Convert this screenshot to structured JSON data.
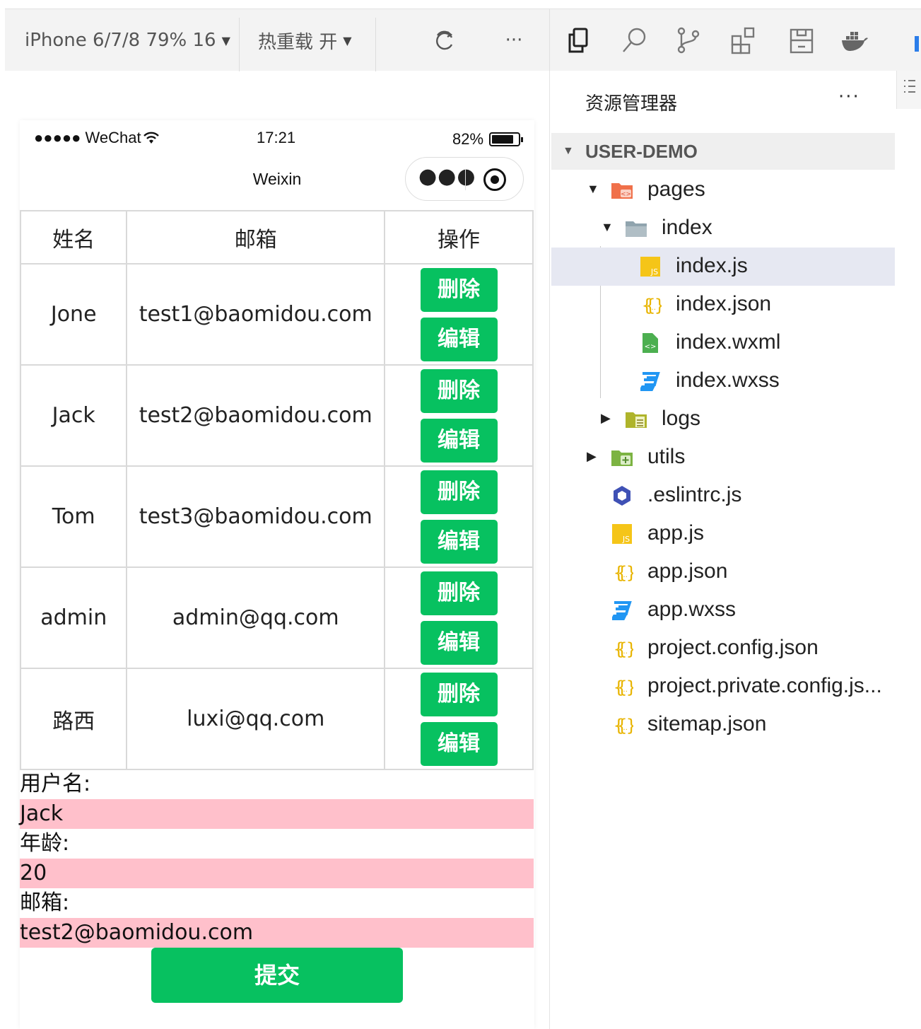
{
  "simulator_toolbar": {
    "device": "iPhone 6/7/8 79% 16",
    "hot_reload": "热重载 开",
    "more": "···"
  },
  "ide_toolbar": {
    "icons": [
      "explorer-icon",
      "search-icon",
      "source-control-icon",
      "extensions-icon",
      "layout-icon",
      "docker-icon"
    ]
  },
  "phone": {
    "status": {
      "carrier": "●●●●● WeChat",
      "time": "17:21",
      "battery": "82%",
      "battery_level": 0.82
    },
    "nav_title": "Weixin",
    "table": {
      "headers": [
        "姓名",
        "邮箱",
        "操作"
      ],
      "rows": [
        {
          "name": "Jone",
          "email": "test1@baomidou.com"
        },
        {
          "name": "Jack",
          "email": "test2@baomidou.com"
        },
        {
          "name": "Tom",
          "email": "test3@baomidou.com"
        },
        {
          "name": "admin",
          "email": "admin@qq.com"
        },
        {
          "name": "路西",
          "email": "luxi@qq.com"
        }
      ],
      "delete_label": "删除",
      "edit_label": "编辑"
    },
    "form": {
      "username_label": "用户名:",
      "username_value": "Jack",
      "age_label": "年龄:",
      "age_value": "20",
      "email_label": "邮箱:",
      "email_value": "test2@baomidou.com",
      "submit_label": "提交"
    }
  },
  "explorer": {
    "title": "资源管理器",
    "more": "···",
    "project": "USER-DEMO",
    "items": [
      {
        "label": "pages",
        "icon": "pages-folder-icon",
        "twisty": "▼"
      },
      {
        "label": "index",
        "icon": "folder-icon",
        "twisty": "▼"
      },
      {
        "label": "index.js",
        "icon": "js-file-icon",
        "twisty": ""
      },
      {
        "label": "index.json",
        "icon": "json-file-icon",
        "twisty": ""
      },
      {
        "label": "index.wxml",
        "icon": "wxml-file-icon",
        "twisty": ""
      },
      {
        "label": "index.wxss",
        "icon": "wxss-file-icon",
        "twisty": ""
      },
      {
        "label": "logs",
        "icon": "logs-folder-icon",
        "twisty": "▶"
      },
      {
        "label": "utils",
        "icon": "utils-folder-icon",
        "twisty": "▶"
      },
      {
        "label": ".eslintrc.js",
        "icon": "eslint-icon",
        "twisty": ""
      },
      {
        "label": "app.js",
        "icon": "js-file-icon",
        "twisty": ""
      },
      {
        "label": "app.json",
        "icon": "json-file-icon",
        "twisty": ""
      },
      {
        "label": "app.wxss",
        "icon": "wxss-file-icon",
        "twisty": ""
      },
      {
        "label": "project.config.json",
        "icon": "json-file-icon",
        "twisty": ""
      },
      {
        "label": "project.private.config.js...",
        "icon": "json-file-icon",
        "twisty": ""
      },
      {
        "label": "sitemap.json",
        "icon": "json-file-icon",
        "twisty": ""
      }
    ]
  },
  "colors": {
    "accent_green": "#07c160",
    "input_bg": "#ffc0cb",
    "selected_row": "#e6e8f2"
  }
}
